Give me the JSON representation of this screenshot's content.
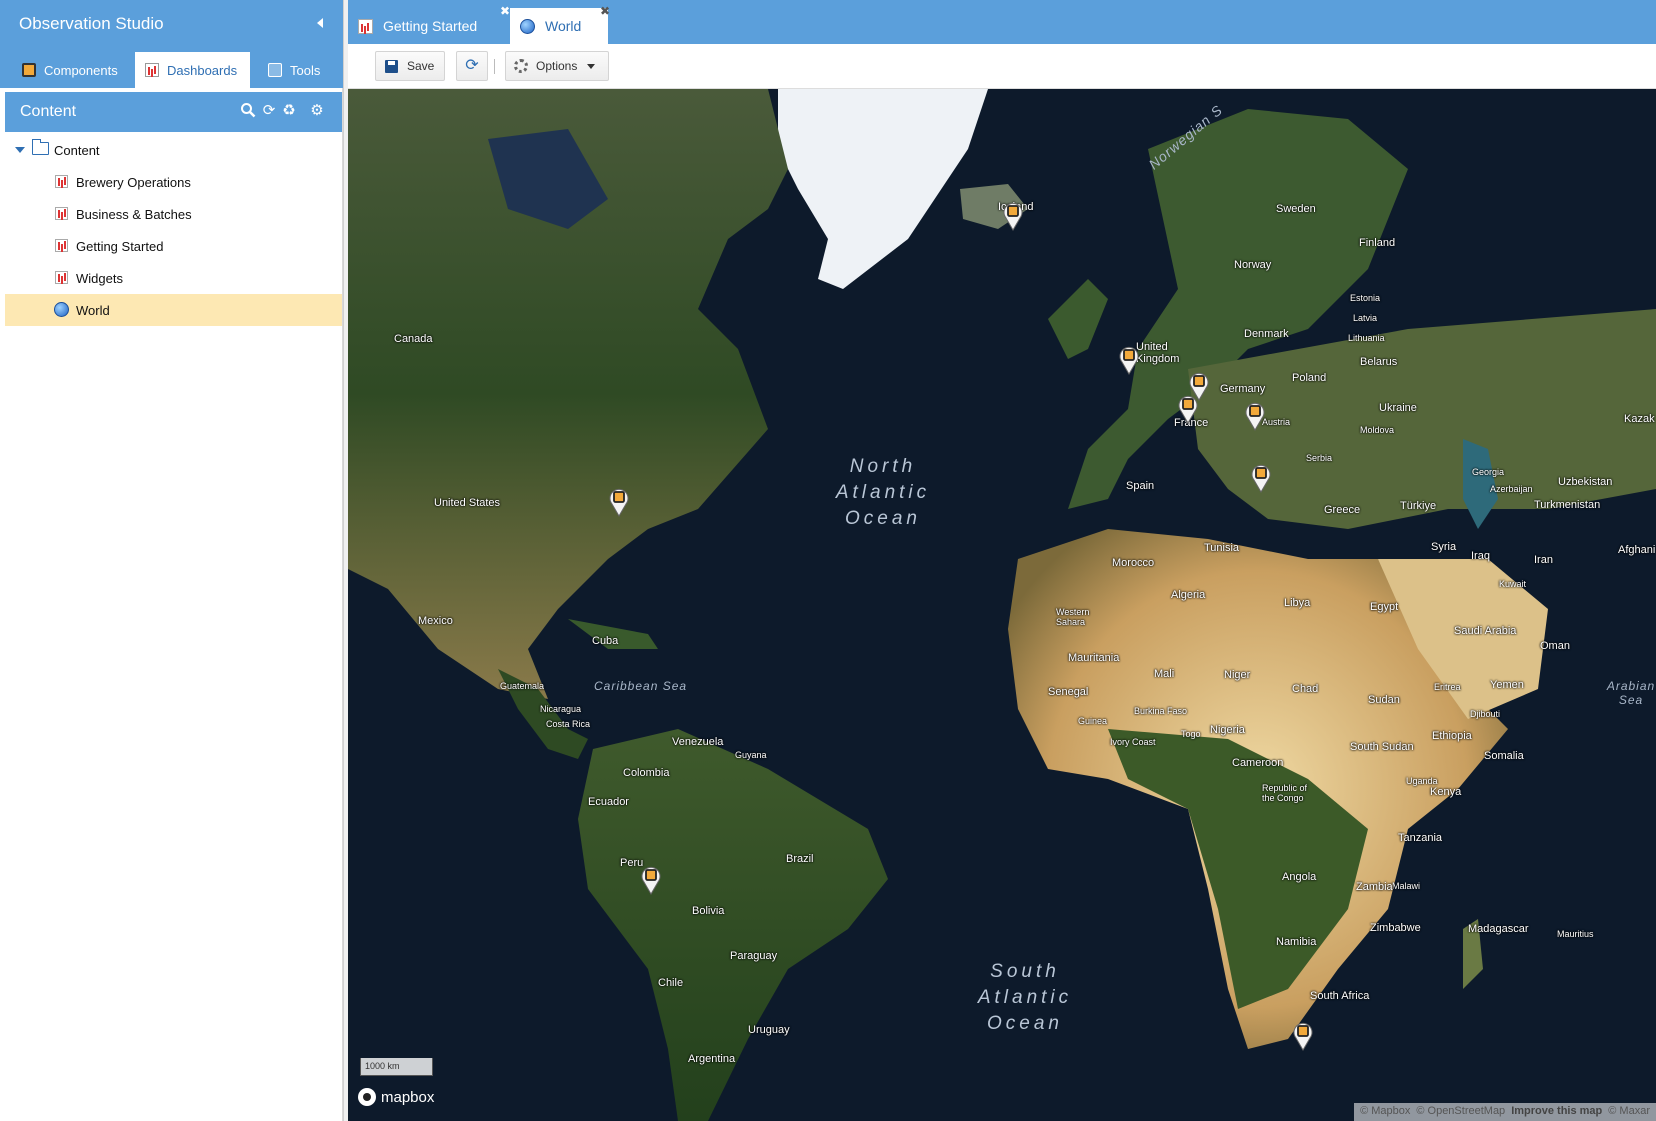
{
  "sidebar": {
    "title": "Observation Studio",
    "tabs": [
      {
        "label": "Components",
        "icon": "components-icon"
      },
      {
        "label": "Dashboards",
        "icon": "dashboards-icon",
        "active": true
      },
      {
        "label": "Tools",
        "icon": "tools-icon"
      }
    ],
    "content_header": "Content",
    "tree": {
      "root": "Content",
      "items": [
        {
          "label": "Brewery Operations",
          "icon": "dashboard-icon"
        },
        {
          "label": "Business & Batches",
          "icon": "dashboard-icon"
        },
        {
          "label": "Getting Started",
          "icon": "dashboard-icon"
        },
        {
          "label": "Widgets",
          "icon": "dashboard-icon"
        },
        {
          "label": "World",
          "icon": "globe-icon",
          "selected": true
        }
      ]
    }
  },
  "tabs": [
    {
      "label": "Getting Started",
      "icon": "dashboard-icon"
    },
    {
      "label": "World",
      "icon": "globe-icon",
      "active": true
    }
  ],
  "toolbar": {
    "save_label": "Save",
    "options_label": "Options"
  },
  "map": {
    "oceans": [
      "North Atlantic Ocean",
      "South Atlantic Ocean"
    ],
    "ocean_lines": {
      "north": [
        "North",
        "Atlantic",
        "Ocean"
      ],
      "south": [
        "South",
        "Atlantic",
        "Ocean"
      ]
    },
    "seas": {
      "caribbean": "Caribbean Sea",
      "norwegian": "Norwegian S",
      "arabian": "Arabian Sea"
    },
    "countries": {
      "iceland": "Iceland",
      "sweden": "Sweden",
      "finland": "Finland",
      "norway": "Norway",
      "estonia": "Estonia",
      "latvia": "Latvia",
      "lithuania": "Lithuania",
      "denmark": "Denmark",
      "uk": "United Kingdom",
      "uk1": "United",
      "uk2": "Kingdom",
      "belarus": "Belarus",
      "poland": "Poland",
      "germany": "Germany",
      "ukraine": "Ukraine",
      "france": "France",
      "austria": "Austria",
      "moldova": "Moldova",
      "serbia": "Serbia",
      "spain": "Spain",
      "greece": "Greece",
      "georgia": "Georgia",
      "azerbaijan": "Azerbaijan",
      "uzbekistan": "Uzbekistan",
      "turkmenistan": "Turkmenistan",
      "turkiye": "Türkiye",
      "kazak": "Kazak",
      "afghani": "Afghani",
      "syria": "Syria",
      "iraq": "Iraq",
      "iran": "Iran",
      "kuwait": "Kuwait",
      "tunisia": "Tunisia",
      "morocco": "Morocco",
      "algeria": "Algeria",
      "libya": "Libya",
      "egypt": "Egypt",
      "saudi": "Saudi Arabia",
      "oman": "Oman",
      "western_sahara": "Western Sahara",
      "ws1": "Western",
      "ws2": "Sahara",
      "mauritania": "Mauritania",
      "mali": "Mali",
      "niger": "Niger",
      "chad": "Chad",
      "sudan": "Sudan",
      "eritrea": "Eritrea",
      "yemen": "Yemen",
      "djibouti": "Djibouti",
      "senegal": "Senegal",
      "guinea": "Guinea",
      "burkina": "Burkina Faso",
      "ivory": "Ivory Coast",
      "togo": "Togo",
      "nigeria": "Nigeria",
      "ethiopia": "Ethiopia",
      "somalia": "Somalia",
      "south_sudan": "South Sudan",
      "cameroon": "Cameroon",
      "uganda": "Uganda",
      "kenya": "Kenya",
      "congo": "Republic of the Congo",
      "congo1": "Republic of",
      "congo2": "the Congo",
      "tanzania": "Tanzania",
      "malawi": "Malawi",
      "angola": "Angola",
      "zambia": "Zambia",
      "zimbabwe": "Zimbabwe",
      "namibia": "Namibia",
      "madagascar": "Madagascar",
      "mauritius": "Mauritius",
      "south_africa": "South Africa",
      "canada": "Canada",
      "us": "United States",
      "mexico": "Mexico",
      "cuba": "Cuba",
      "guatemala": "Guatemala",
      "nicaragua": "Nicaragua",
      "costa_rica": "Costa Rica",
      "venezuela": "Venezuela",
      "guyana": "Guyana",
      "colombia": "Colombia",
      "ecuador": "Ecuador",
      "peru": "Peru",
      "brazil": "Brazil",
      "bolivia": "Bolivia",
      "paraguay": "Paraguay",
      "chile": "Chile",
      "uruguay": "Uruguay",
      "argentina": "Argentina"
    },
    "scale_label": "1000 km",
    "logo_label": "mapbox",
    "attribution": {
      "mapbox": "© Mapbox",
      "osm": "© OpenStreetMap",
      "improve": "Improve this map",
      "maxar": "© Maxar"
    },
    "colors": {
      "ocean": "#0d1a2b",
      "land": "#2f4a24",
      "desert": "#cdb07a",
      "ice": "#eef2f6",
      "marker_body": "#f2a93b"
    }
  }
}
